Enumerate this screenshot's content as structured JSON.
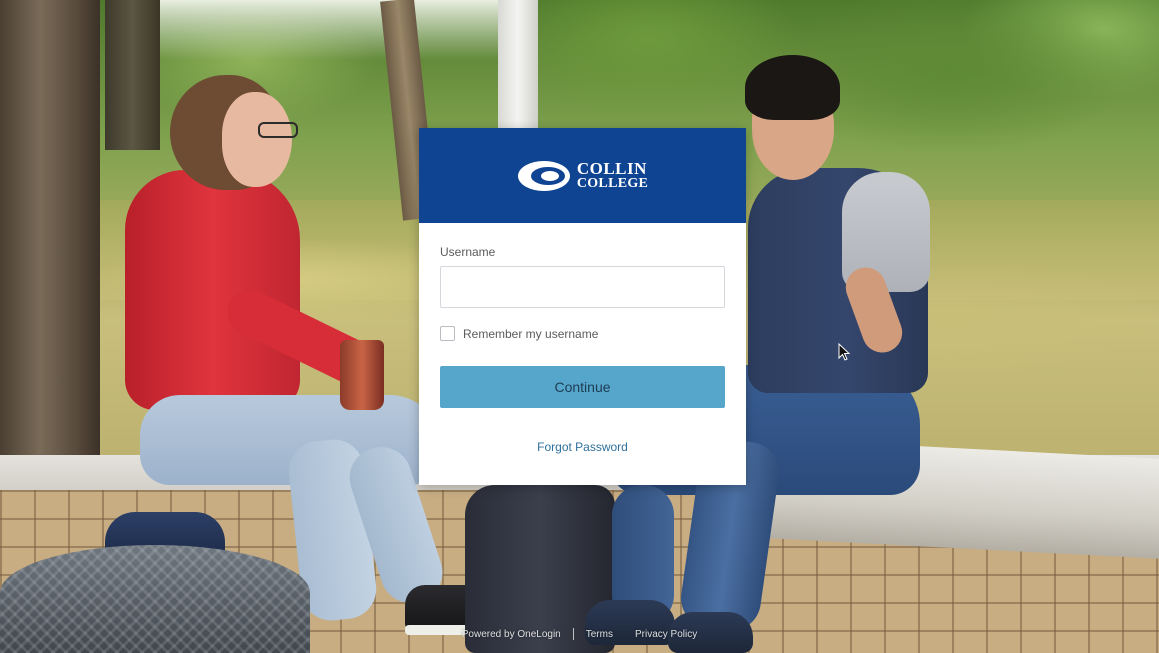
{
  "brand": {
    "logo_line1": "COLLIN",
    "logo_line2": "COLLEGE",
    "header_color": "#0f4493",
    "accent_color": "#56a6cc"
  },
  "login": {
    "username_label": "Username",
    "username_value": "",
    "username_placeholder": "",
    "remember_label": "Remember my username",
    "remember_checked": false,
    "continue_label": "Continue",
    "forgot_label": "Forgot Password"
  },
  "footer": {
    "powered_by": "Powered by OneLogin",
    "terms": "Terms",
    "privacy": "Privacy Policy"
  }
}
